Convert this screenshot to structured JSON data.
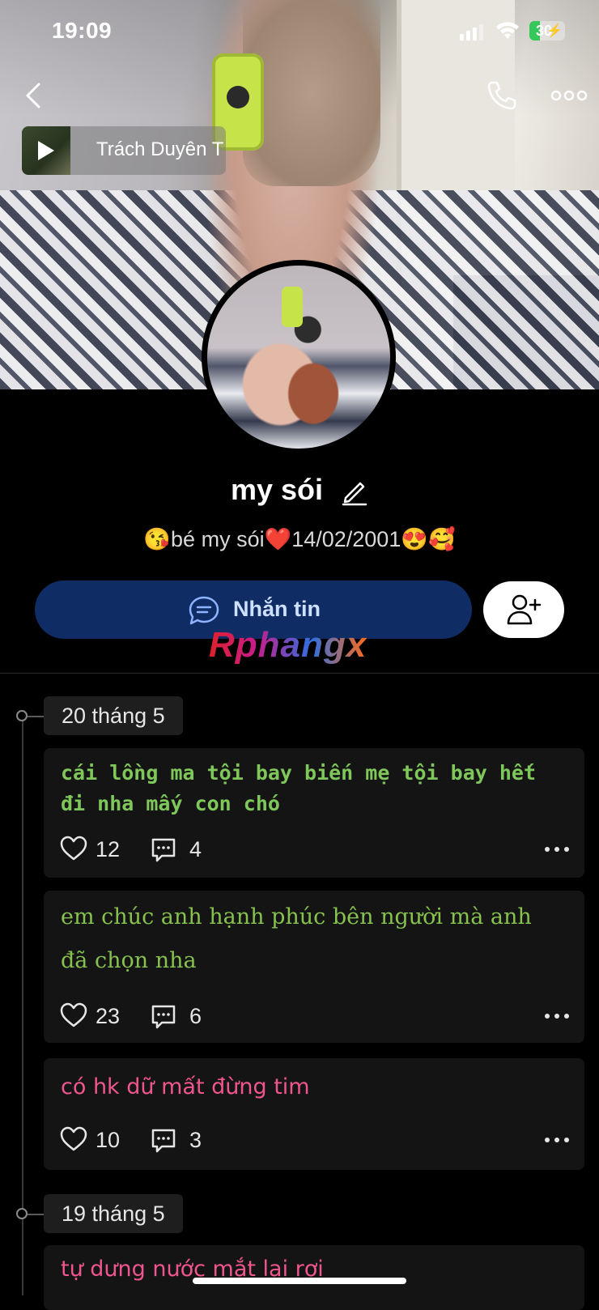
{
  "status_bar": {
    "time": "19:09",
    "battery": "30",
    "battery_level": 0.3
  },
  "music": {
    "title": "Trách Duyên T"
  },
  "profile": {
    "name": "my sói",
    "bio": "😘bé my sói❤️14/02/2001😍🥰"
  },
  "actions": {
    "message_label": "Nhắn tin"
  },
  "watermark": "Rphangx",
  "timeline": [
    {
      "date": "20 tháng 5",
      "posts": [
        {
          "text": "cái lồng ma tội bay biến mẹ tội bay hết đi nha mấy con chó",
          "likes": "12",
          "comments": "4"
        },
        {
          "text": "em chúc anh hạnh phúc bên người mà anh đã chọn nha",
          "likes": "23",
          "comments": "6"
        },
        {
          "text": "có hk dữ mất đừng tim",
          "likes": "10",
          "comments": "3"
        }
      ]
    },
    {
      "date": "19 tháng 5",
      "posts": [
        {
          "text": "tự dưng nước mắt lại rơi"
        }
      ]
    }
  ],
  "colors": {
    "accent_button": "#0f2c65",
    "post_green": "#86c24d",
    "post_pink": "#f0558f",
    "battery_green": "#35c759"
  },
  "icons": [
    "back-icon",
    "phone-icon",
    "more-icon",
    "play-icon",
    "edit-icon",
    "chat-icon",
    "add-friend-icon",
    "heart-icon",
    "comment-icon",
    "dots-icon"
  ]
}
